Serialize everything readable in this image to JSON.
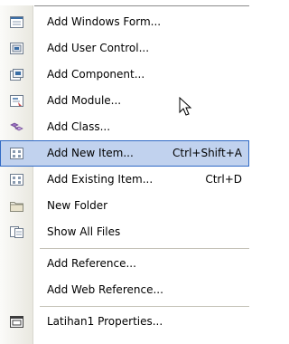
{
  "menu": {
    "items": [
      {
        "label": "Add Windows Form...",
        "shortcut": "",
        "icon": "windows-form-icon"
      },
      {
        "label": "Add User Control...",
        "shortcut": "",
        "icon": "user-control-icon"
      },
      {
        "label": "Add Component...",
        "shortcut": "",
        "icon": "component-icon"
      },
      {
        "label": "Add Module...",
        "shortcut": "",
        "icon": "module-icon"
      },
      {
        "label": "Add Class...",
        "shortcut": "",
        "icon": "class-icon"
      },
      {
        "label": "Add New Item...",
        "shortcut": "Ctrl+Shift+A",
        "icon": "new-item-icon"
      },
      {
        "label": "Add Existing Item...",
        "shortcut": "Ctrl+D",
        "icon": "existing-item-icon"
      },
      {
        "label": "New Folder",
        "shortcut": "",
        "icon": "folder-icon"
      },
      {
        "label": "Show All Files",
        "shortcut": "",
        "icon": "show-all-files-icon"
      },
      {
        "label": "Add Reference...",
        "shortcut": "",
        "icon": ""
      },
      {
        "label": "Add Web Reference...",
        "shortcut": "",
        "icon": ""
      },
      {
        "label": "Latihan1 Properties...",
        "shortcut": "",
        "icon": "properties-icon"
      }
    ],
    "highlighted_index": 5,
    "colors": {
      "highlight_bg": "#c1d2ee",
      "highlight_border": "#316ac5"
    }
  }
}
